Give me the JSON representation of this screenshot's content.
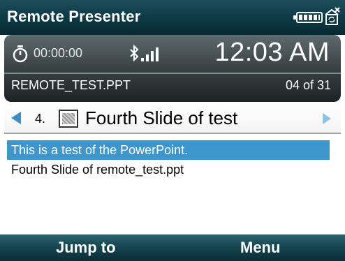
{
  "titlebar": {
    "title": "Remote Presenter",
    "icons": [
      "battery-icon",
      "sync-icon"
    ]
  },
  "status": {
    "elapsed_time": "00:00:00",
    "clock": "12:03 AM",
    "filename": "REMOTE_TEST.PPT",
    "position": "04 of 31",
    "icons": [
      "timer-icon",
      "bluetooth-signal-icon"
    ]
  },
  "slide_nav": {
    "number": "4.",
    "title": "Fourth Slide of test",
    "icons": [
      "previous-arrow-icon",
      "slide-thumbnail-icon",
      "next-arrow-icon"
    ]
  },
  "notes": [
    "This is a test of the PowerPoint.",
    "Fourth Slide of remote_test.ppt"
  ],
  "softkeys": {
    "left": "Jump to",
    "right": "Menu"
  },
  "colors": {
    "titlebar": "#0e3a46",
    "selection": "#3f96cc",
    "arrow": "#3b8dc9",
    "status_panel": "#3d4547"
  }
}
